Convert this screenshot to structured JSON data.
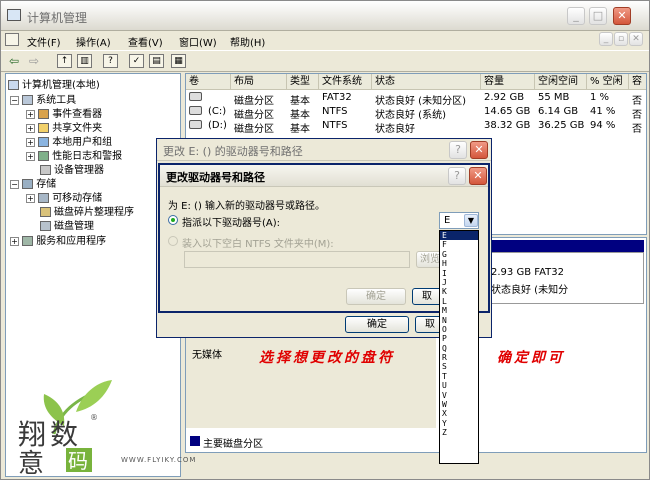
{
  "window": {
    "title": "计算机管理"
  },
  "menu": [
    "文件(F)",
    "操作(A)",
    "查看(V)",
    "窗口(W)",
    "帮助(H)"
  ],
  "tree": {
    "root": "计算机管理(本地)",
    "system_tools": "系统工具",
    "event_viewer": "事件查看器",
    "shared_folders": "共享文件夹",
    "local_users": "本地用户和组",
    "perf_logs": "性能日志和警报",
    "device_manager": "设备管理器",
    "storage": "存储",
    "removable": "可移动存储",
    "defrag": "磁盘碎片整理程序",
    "disk_mgmt": "磁盘管理",
    "services": "服务和应用程序"
  },
  "volumes": {
    "headers": [
      "卷",
      "布局",
      "类型",
      "文件系统",
      "状态",
      "容量",
      "空闲空间",
      "% 空闲",
      "容"
    ],
    "rows": [
      [
        "",
        "磁盘分区",
        "基本",
        "FAT32",
        "状态良好 (未知分区)",
        "2.92 GB",
        "55 MB",
        "1 %",
        "否"
      ],
      [
        "(C:)",
        "磁盘分区",
        "基本",
        "NTFS",
        "状态良好 (系统)",
        "14.65 GB",
        "6.14 GB",
        "41 %",
        "否"
      ],
      [
        "(D:)",
        "磁盘分区",
        "基本",
        "NTFS",
        "状态良好",
        "38.32 GB",
        "36.25 GB",
        "94 %",
        "否"
      ]
    ]
  },
  "disk_panel": {
    "partition_size": "2.93 GB FAT32",
    "partition_status": "状态良好 (未知分",
    "no_media": "无媒体",
    "legend": "主要磁盘分区"
  },
  "outer_dialog": {
    "title": "更改 E: () 的驱动器号和路径",
    "ok": "确定",
    "cancel": "取"
  },
  "inner_dialog": {
    "title": "更改驱动器号和路径",
    "prompt": "为 E: () 输入新的驱动器号或路径。",
    "opt_letter": "指派以下驱动器号(A):",
    "opt_folder": "装入以下空白 NTFS 文件夹中(M):",
    "browse": "浏览",
    "ok": "确定",
    "cancel": "取",
    "selected_letter": "E",
    "letters": [
      "E",
      "F",
      "G",
      "H",
      "I",
      "J",
      "K",
      "L",
      "M",
      "N",
      "O",
      "P",
      "Q",
      "R",
      "S",
      "T",
      "U",
      "V",
      "W",
      "X",
      "Y",
      "Z"
    ]
  },
  "annotation": {
    "left": "选择想更改的盘符",
    "right": "确定即可"
  },
  "watermark": {
    "url": "WWW.FLYIKY.COM"
  },
  "colors": {
    "selection": "#0a246a",
    "annotation": "#e00000",
    "partition_bar": "#000080"
  }
}
